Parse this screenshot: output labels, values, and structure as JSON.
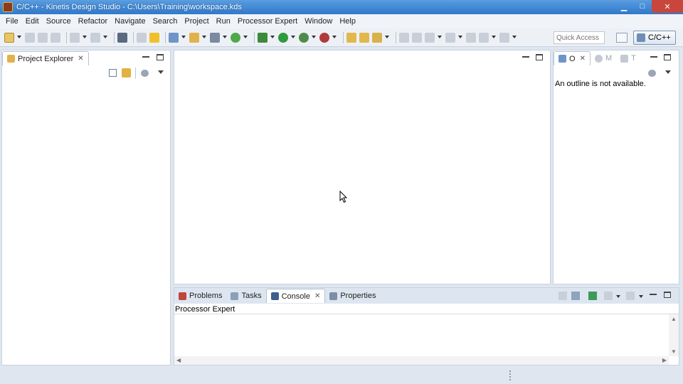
{
  "window": {
    "title": "C/C++ - Kinetis Design Studio - C:\\Users\\Training\\workspace.kds",
    "minimize": "▁",
    "maximize": "□",
    "close": "✕"
  },
  "menu": [
    "File",
    "Edit",
    "Source",
    "Refactor",
    "Navigate",
    "Search",
    "Project",
    "Run",
    "Processor Expert",
    "Window",
    "Help"
  ],
  "toolbar": {
    "quick_access_placeholder": "Quick Access",
    "perspective_label": "C/C++"
  },
  "project_explorer": {
    "tab_label": "Project Explorer",
    "close_glyph": "✕"
  },
  "outline": {
    "tabs": [
      "O",
      "M",
      "T"
    ],
    "message": "An outline is not available."
  },
  "bottom_panel": {
    "tabs": [
      {
        "label": "Problems",
        "active": false
      },
      {
        "label": "Tasks",
        "active": false
      },
      {
        "label": "Console",
        "active": true
      },
      {
        "label": "Properties",
        "active": false
      }
    ],
    "console_title": "Processor Expert"
  },
  "colors": {
    "title_bar": "#2f79c9",
    "close_button": "#c9463d",
    "workbench_bg": "#dfe6ef"
  }
}
